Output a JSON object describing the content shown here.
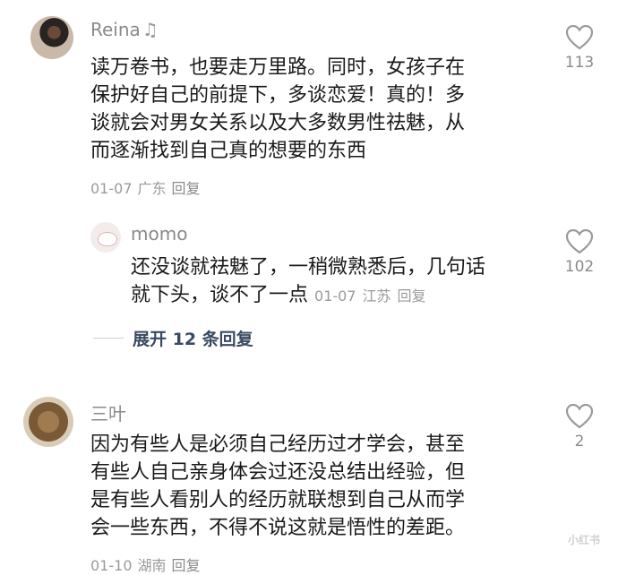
{
  "comments": [
    {
      "username": "Reina",
      "username_icon": "music-note-icon",
      "text": "读万卷书，也要走万里路。同时，女孩子在\n保护好自己的前提下，多谈恋爱！真的！多\n谈就会对男女关系以及大多数男性祛魅，从\n而逐渐找到自己真的想要的东西",
      "date": "01-07",
      "location": "广东",
      "reply_label": "回复",
      "likes": "113"
    },
    {
      "username": "momo",
      "text": "还没谈就祛魅了，一稍微熟悉后，几句话\n就下头，谈不了一点",
      "date": "01-07",
      "location": "江苏",
      "reply_label": "回复",
      "likes": "102"
    },
    {
      "username": "三叶",
      "text": "因为有些人是必须自己经历过才学会，甚至\n有些人自己亲身体会过还没总结出经验，但\n是有些人看别人的经历就联想到自己从而学\n会一些东西，不得不说这就是悟性的差距。",
      "date": "01-10",
      "location": "湖南",
      "reply_label": "回复",
      "likes": "2"
    }
  ],
  "expand_replies_label": "展开 12 条回复",
  "watermark": "小红书"
}
